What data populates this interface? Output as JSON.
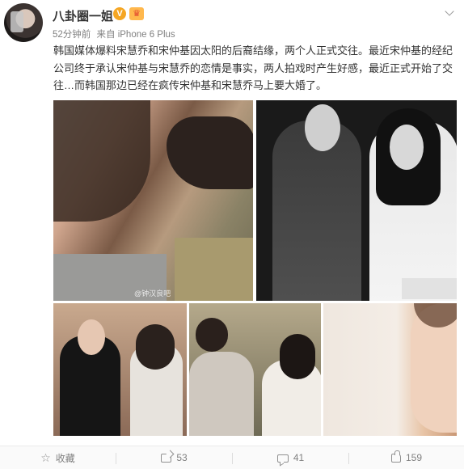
{
  "post": {
    "username": "八卦圈一姐",
    "verified_badge": "V",
    "member_badge": "♛",
    "time": "52分钟前",
    "source": "来自 iPhone 6 Plus",
    "text": "韩国媒体爆料宋慧乔和宋仲基因太阳的后裔结缘，两个人正式交往。最近宋仲基的经纪公司终于承认宋仲基与宋慧乔的恋情是事实，两人拍戏时产生好感，最近正式开始了交往…而韩国那边已经在疯传宋仲基和宋慧乔马上要大婚了。",
    "image_watermark": "@钟汉良吧"
  },
  "footer": {
    "favorite_label": "收藏",
    "share_count": "53",
    "comment_count": "41",
    "like_count": "159"
  },
  "icons": {
    "favorite": "star-icon",
    "share": "share-icon",
    "comment": "comment-icon",
    "like": "thumbs-up-icon",
    "more": "chevron-down-icon"
  },
  "colors": {
    "text": "#333333",
    "meta": "#808080",
    "badge_v": "#f5a623"
  }
}
